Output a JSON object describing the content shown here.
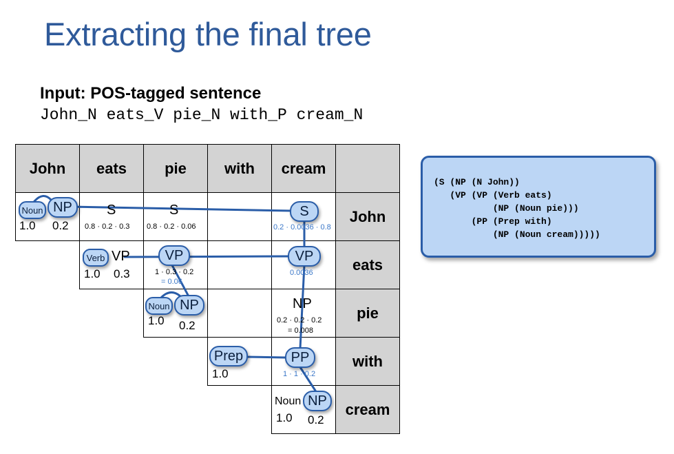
{
  "title": "Extracting the final tree",
  "input_label": "Input: POS-tagged sentence",
  "sentence": "John_N eats_V pie_N with_P cream_N",
  "chart": {
    "columns": [
      "John",
      "eats",
      "pie",
      "with",
      "cream"
    ],
    "rows": [
      "John",
      "eats",
      "pie",
      "with",
      "cream"
    ],
    "cells": {
      "r0c0": {
        "noun": "Noun",
        "np": "NP",
        "p1": "1.0",
        "p2": "0.2"
      },
      "r0c1": {
        "label": "S",
        "prob": "0.8 · 0.2 · 0.3"
      },
      "r0c2": {
        "label": "S",
        "prob": "0.8 · 0.2 · 0.06"
      },
      "r0c4": {
        "label": "S",
        "prob": "0.2 · 0.0036 · 0.8"
      },
      "r1c1": {
        "verb": "Verb",
        "vp": "VP",
        "p1": "1.0",
        "p2": "0.3"
      },
      "r1c2": {
        "label": "VP",
        "prob1": "1 · 0.3 · 0.2",
        "prob2": "= 0.06"
      },
      "r1c4": {
        "label": "VP",
        "prob": "0.0036"
      },
      "r2c2": {
        "noun": "Noun",
        "np": "NP",
        "p1": "1.0",
        "p2": "0.2"
      },
      "r2c4": {
        "label": "NP",
        "prob1": "0.2 · 0.2 · 0.2",
        "prob2": "= 0.008"
      },
      "r3c3": {
        "label": "Prep",
        "p1": "1.0"
      },
      "r3c4": {
        "label": "PP",
        "prob": "1 · 1 · 0.2"
      },
      "r4c4": {
        "noun": "Noun",
        "np": "NP",
        "p1": "1.0",
        "p2": "0.2"
      }
    }
  },
  "parse_tree": [
    "(S (NP (N John))",
    "   (VP (VP (Verb eats)",
    "           (NP (Noun pie)))",
    "       (PP (Prep with)",
    "           (NP (Noun cream)))))"
  ],
  "colors": {
    "title": "#2f5a9a",
    "bubble_fill": "#bcd6f5",
    "bubble_border": "#2a5da8",
    "header_fill": "#d3d3d3",
    "line": "#2a5da8"
  }
}
